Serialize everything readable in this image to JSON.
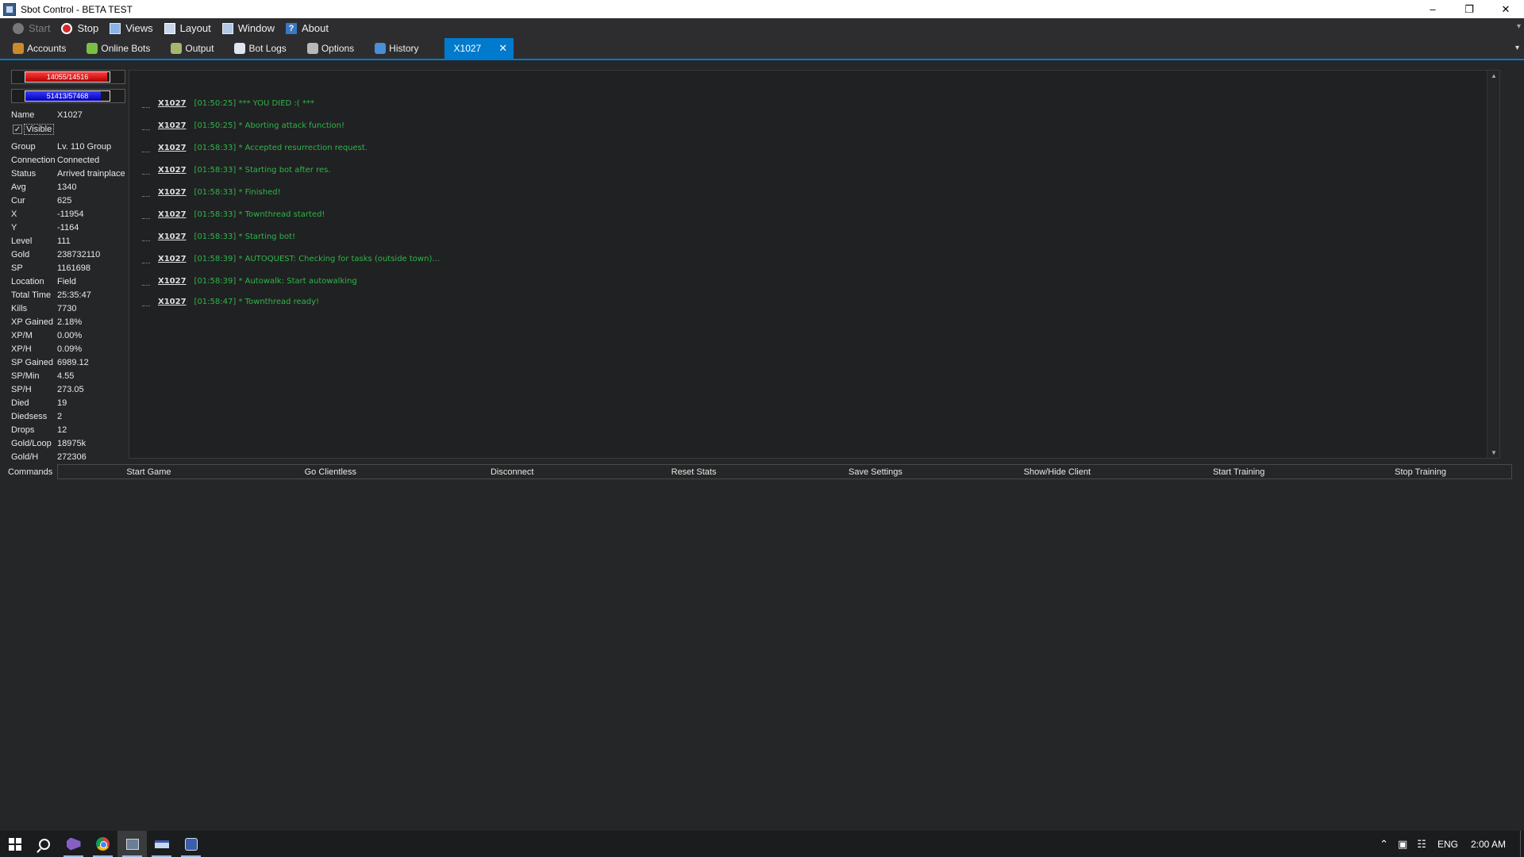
{
  "window": {
    "title": "Sbot Control - BETA TEST"
  },
  "menu": [
    {
      "label": "Start",
      "icon": "start-icon",
      "enabled": false
    },
    {
      "label": "Stop",
      "icon": "stop-icon",
      "enabled": true
    },
    {
      "label": "Views",
      "icon": "views-icon",
      "enabled": true
    },
    {
      "label": "Layout",
      "icon": "layout-icon",
      "enabled": true
    },
    {
      "label": "Window",
      "icon": "window-icon",
      "enabled": true
    },
    {
      "label": "About",
      "icon": "about-icon",
      "enabled": true
    }
  ],
  "tabs": [
    {
      "label": "Accounts",
      "icon": "accounts-icon"
    },
    {
      "label": "Online Bots",
      "icon": "online-bots-icon"
    },
    {
      "label": "Output",
      "icon": "output-icon"
    },
    {
      "label": "Bot Logs",
      "icon": "bot-logs-icon"
    },
    {
      "label": "Options",
      "icon": "options-icon"
    },
    {
      "label": "History",
      "icon": "history-icon"
    },
    {
      "label": "X1027",
      "icon": "close-icon",
      "active": true
    }
  ],
  "bars": {
    "hp": {
      "label": "14055/14516",
      "fraction": 0.968
    },
    "mp": {
      "label": "51413/57468",
      "fraction": 0.895
    }
  },
  "stats_top": {
    "name_key": "Name",
    "name_value": "X1027",
    "visible_label": "Visible",
    "visible_checked": true
  },
  "stats": [
    {
      "k": "Group",
      "v": "Lv. 110 Group"
    },
    {
      "k": "Connection",
      "v": "Connected"
    },
    {
      "k": "Status",
      "v": "Arrived trainplace"
    },
    {
      "k": "Avg",
      "v": "1340"
    },
    {
      "k": "Cur",
      "v": "625"
    },
    {
      "k": "X",
      "v": "-11954"
    },
    {
      "k": "Y",
      "v": "-1164"
    },
    {
      "k": "Level",
      "v": "111"
    },
    {
      "k": "Gold",
      "v": "238732110"
    },
    {
      "k": "SP",
      "v": "1161698"
    },
    {
      "k": "Location",
      "v": "Field"
    },
    {
      "k": "Total Time",
      "v": "25:35:47"
    },
    {
      "k": "Kills",
      "v": "7730"
    },
    {
      "k": "XP Gained",
      "v": "2.18%"
    },
    {
      "k": "XP/M",
      "v": "0.00%"
    },
    {
      "k": "XP/H",
      "v": "0.09%"
    },
    {
      "k": "SP Gained",
      "v": "6989.12"
    },
    {
      "k": "SP/Min",
      "v": "4.55"
    },
    {
      "k": "SP/H",
      "v": "273.05"
    },
    {
      "k": "Died",
      "v": "19"
    },
    {
      "k": "Diedsess",
      "v": "2"
    },
    {
      "k": "Drops",
      "v": "12"
    },
    {
      "k": "Gold/Loop",
      "v": "18975k"
    },
    {
      "k": "Gold/H",
      "v": "272306"
    }
  ],
  "log": [
    {
      "bot": "X1027",
      "msg": "[01:50:25] *** YOU DIED :( ***"
    },
    {
      "bot": "X1027",
      "msg": "[01:50:25] * Aborting attack function!"
    },
    {
      "bot": "X1027",
      "msg": "[01:58:33] * Accepted resurrection request."
    },
    {
      "bot": "X1027",
      "msg": "[01:58:33] * Starting bot after res."
    },
    {
      "bot": "X1027",
      "msg": "[01:58:33] * Finished!"
    },
    {
      "bot": "X1027",
      "msg": "[01:58:33] * Townthread started!"
    },
    {
      "bot": "X1027",
      "msg": "[01:58:33] * Starting bot!"
    },
    {
      "bot": "X1027",
      "msg": "[01:58:39] * AUTOQUEST: Checking for tasks (outside town)..."
    },
    {
      "bot": "X1027",
      "msg": "[01:58:39] * Autowalk: Start autowalking"
    },
    {
      "bot": "X1027",
      "msg": "[01:58:47] * Townthread ready!"
    }
  ],
  "commands": {
    "label": "Commands",
    "buttons": [
      "Start Game",
      "Go Clientless",
      "Disconnect",
      "Reset Stats",
      "Save Settings",
      "Show/Hide Client",
      "Start Training",
      "Stop Training"
    ]
  },
  "taskbar": {
    "apps": [
      "windows-start-icon",
      "search-icon",
      "visual-studio-icon",
      "chrome-icon",
      "sbot-app-icon",
      "app-window-icon",
      "sbot-control-icon"
    ],
    "language": "ENG",
    "clock": "2:00 AM"
  },
  "colors": {
    "accent": "#007acc",
    "log_text": "#2fb54a",
    "hp": "#e00000",
    "mp": "#0000e0"
  }
}
